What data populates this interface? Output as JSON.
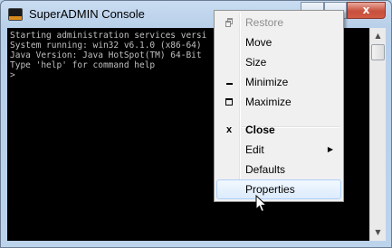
{
  "window": {
    "title": "SuperADMIN Console",
    "close_glyph": "x"
  },
  "console": {
    "lines": [
      "Starting administration services versi",
      "System running: win32 v6.1.0 (x86-64)",
      "Java Version: Java HotSpot(TM) 64-Bit",
      "Type 'help' for command help",
      ">"
    ]
  },
  "system_menu": {
    "items": [
      {
        "label": "Restore",
        "icon": "restore-icon",
        "disabled": true
      },
      {
        "label": "Move"
      },
      {
        "label": "Size"
      },
      {
        "label": "Minimize",
        "icon": "minimize-icon"
      },
      {
        "label": "Maximize",
        "icon": "maximize-icon"
      },
      {
        "label": "Close",
        "icon": "close-icon",
        "icon_glyph": "x",
        "bold": true
      },
      {
        "label": "Edit",
        "submenu": true
      },
      {
        "label": "Defaults"
      },
      {
        "label": "Properties",
        "highlighted": true
      }
    ]
  },
  "colors": {
    "console_bg": "#000000",
    "console_text": "#c0c0c0",
    "menu_bg": "#f0f0f0",
    "highlight_border": "#aecff7",
    "close_button": "#c7503c"
  }
}
